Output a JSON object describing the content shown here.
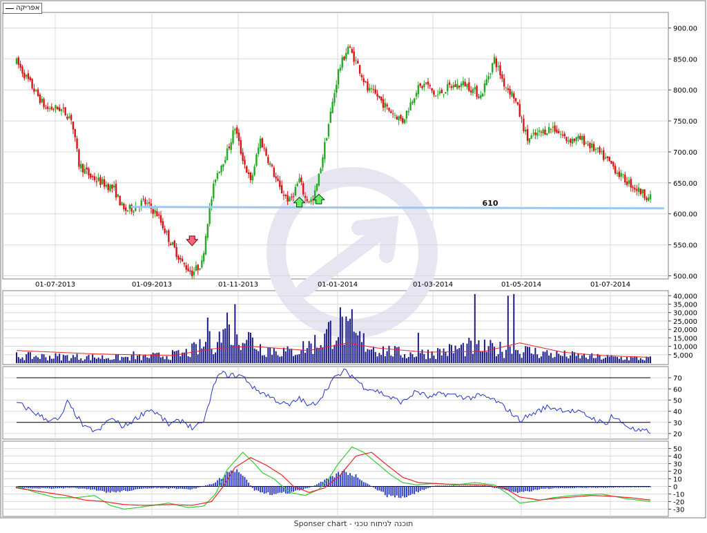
{
  "legend": {
    "label": "אפריקה"
  },
  "footer": {
    "text": "Sponser chart - תוכנה לניתוח טכני"
  },
  "colors": {
    "up": "#22aa22",
    "down": "#dd1111",
    "volume": "#1a1a8c",
    "ma": "#ee2222",
    "rsi": "#2233cc",
    "macd_fast": "#33cc33",
    "macd_slow": "#ee2222",
    "hist": "#2233cc",
    "support": "#9cc8f0",
    "grid": "#d8d8d8"
  },
  "chart_data": [
    {
      "type": "candlestick",
      "x_ticks": [
        "01-07-2013",
        "01-09-2013",
        "01-11-2013",
        "01-01-2014",
        "01-03-2014",
        "01-05-2014",
        "01-07-2014"
      ],
      "y_ticks": [
        "500.00",
        "550.00",
        "600.00",
        "650.00",
        "700.00",
        "750.00",
        "800.00",
        "850.00",
        "900.00"
      ],
      "ylim": [
        495,
        925
      ],
      "support_line": {
        "value": 610,
        "label": "610"
      },
      "keypoints": [
        [
          0,
          845
        ],
        [
          8,
          805
        ],
        [
          15,
          770
        ],
        [
          22,
          770
        ],
        [
          28,
          755
        ],
        [
          32,
          680
        ],
        [
          38,
          660
        ],
        [
          44,
          650
        ],
        [
          50,
          640
        ],
        [
          55,
          605
        ],
        [
          60,
          610
        ],
        [
          65,
          620
        ],
        [
          72,
          600
        ],
        [
          78,
          560
        ],
        [
          85,
          520
        ],
        [
          90,
          505
        ],
        [
          95,
          520
        ],
        [
          98,
          590
        ],
        [
          102,
          660
        ],
        [
          108,
          700
        ],
        [
          112,
          740
        ],
        [
          115,
          700
        ],
        [
          120,
          650
        ],
        [
          125,
          720
        ],
        [
          130,
          680
        ],
        [
          135,
          640
        ],
        [
          140,
          620
        ],
        [
          145,
          655
        ],
        [
          148,
          625
        ],
        [
          152,
          620
        ],
        [
          155,
          660
        ],
        [
          160,
          745
        ],
        [
          165,
          830
        ],
        [
          170,
          870
        ],
        [
          175,
          840
        ],
        [
          180,
          800
        ],
        [
          185,
          790
        ],
        [
          190,
          770
        ],
        [
          198,
          750
        ],
        [
          205,
          800
        ],
        [
          210,
          810
        ],
        [
          215,
          790
        ],
        [
          222,
          805
        ],
        [
          230,
          810
        ],
        [
          238,
          790
        ],
        [
          245,
          850
        ],
        [
          250,
          810
        ],
        [
          255,
          790
        ],
        [
          262,
          720
        ],
        [
          268,
          730
        ],
        [
          275,
          740
        ],
        [
          282,
          720
        ],
        [
          290,
          720
        ],
        [
          298,
          700
        ],
        [
          305,
          680
        ],
        [
          310,
          660
        ],
        [
          318,
          640
        ],
        [
          325,
          625
        ]
      ],
      "arrows": [
        {
          "dir": "down",
          "index": 90
        },
        {
          "dir": "up",
          "index": 145
        },
        {
          "dir": "up",
          "index": 155
        }
      ]
    },
    {
      "type": "bar",
      "name": "volume",
      "y_ticks": [
        "5,000",
        "10,000",
        "15,000",
        "20,000",
        "25,000",
        "30,000",
        "35,000",
        "40,000"
      ],
      "ylim": [
        0,
        43000
      ],
      "keypoints": [
        [
          0,
          4000
        ],
        [
          30,
          3500
        ],
        [
          60,
          3000
        ],
        [
          85,
          5000
        ],
        [
          95,
          9000
        ],
        [
          105,
          15000
        ],
        [
          115,
          18000
        ],
        [
          125,
          9000
        ],
        [
          140,
          6000
        ],
        [
          155,
          12000
        ],
        [
          165,
          22000
        ],
        [
          172,
          15000
        ],
        [
          185,
          8000
        ],
        [
          200,
          5000
        ],
        [
          215,
          6000
        ],
        [
          232,
          9000
        ],
        [
          245,
          8000
        ],
        [
          260,
          7000
        ],
        [
          275,
          5000
        ],
        [
          295,
          3500
        ],
        [
          325,
          2500
        ]
      ],
      "spikes": [
        [
          98,
          27000
        ],
        [
          108,
          30000
        ],
        [
          112,
          35000
        ],
        [
          170,
          25000
        ],
        [
          172,
          32000
        ],
        [
          235,
          41000
        ],
        [
          252,
          40000
        ],
        [
          255,
          41000
        ],
        [
          206,
          18000
        ],
        [
          60,
          7000
        ]
      ],
      "ma_keypoints": [
        [
          0,
          7500
        ],
        [
          40,
          5500
        ],
        [
          80,
          4500
        ],
        [
          100,
          8500
        ],
        [
          120,
          10000
        ],
        [
          150,
          7500
        ],
        [
          170,
          12000
        ],
        [
          185,
          9000
        ],
        [
          210,
          6500
        ],
        [
          240,
          7000
        ],
        [
          258,
          12000
        ],
        [
          280,
          6500
        ],
        [
          300,
          4500
        ],
        [
          325,
          3500
        ]
      ]
    },
    {
      "type": "line",
      "name": "rsi",
      "y_ticks": [
        "20",
        "30",
        "40",
        "50",
        "60",
        "70"
      ],
      "ylim": [
        15,
        80
      ],
      "levels": [
        30,
        70
      ],
      "keypoints": [
        [
          0,
          48
        ],
        [
          8,
          40
        ],
        [
          15,
          33
        ],
        [
          22,
          32
        ],
        [
          26,
          48
        ],
        [
          30,
          38
        ],
        [
          35,
          25
        ],
        [
          42,
          22
        ],
        [
          48,
          34
        ],
        [
          55,
          26
        ],
        [
          60,
          32
        ],
        [
          68,
          42
        ],
        [
          72,
          38
        ],
        [
          78,
          28
        ],
        [
          85,
          32
        ],
        [
          90,
          25
        ],
        [
          95,
          28
        ],
        [
          98,
          42
        ],
        [
          102,
          68
        ],
        [
          105,
          74
        ],
        [
          110,
          72
        ],
        [
          115,
          72
        ],
        [
          118,
          68
        ],
        [
          122,
          60
        ],
        [
          128,
          55
        ],
        [
          135,
          48
        ],
        [
          140,
          45
        ],
        [
          145,
          52
        ],
        [
          150,
          44
        ],
        [
          155,
          50
        ],
        [
          162,
          68
        ],
        [
          168,
          76
        ],
        [
          172,
          72
        ],
        [
          178,
          62
        ],
        [
          185,
          58
        ],
        [
          192,
          52
        ],
        [
          198,
          48
        ],
        [
          205,
          58
        ],
        [
          212,
          52
        ],
        [
          218,
          56
        ],
        [
          225,
          54
        ],
        [
          232,
          52
        ],
        [
          238,
          54
        ],
        [
          245,
          50
        ],
        [
          250,
          44
        ],
        [
          258,
          32
        ],
        [
          265,
          38
        ],
        [
          272,
          44
        ],
        [
          278,
          42
        ],
        [
          285,
          40
        ],
        [
          290,
          38
        ],
        [
          295,
          34
        ],
        [
          302,
          28
        ],
        [
          305,
          36
        ],
        [
          312,
          28
        ],
        [
          318,
          22
        ],
        [
          325,
          22
        ]
      ]
    },
    {
      "type": "line",
      "name": "macd",
      "y_ticks": [
        "-30",
        "-20",
        "-10",
        "0",
        "10",
        "20",
        "30",
        "40",
        "50"
      ],
      "ylim": [
        -36,
        56
      ],
      "zero_line": true,
      "fast_keypoints": [
        [
          0,
          0
        ],
        [
          10,
          -8
        ],
        [
          20,
          -15
        ],
        [
          30,
          -15
        ],
        [
          40,
          -12
        ],
        [
          48,
          -25
        ],
        [
          55,
          -30
        ],
        [
          62,
          -28
        ],
        [
          70,
          -25
        ],
        [
          78,
          -22
        ],
        [
          88,
          -28
        ],
        [
          96,
          -26
        ],
        [
          102,
          -10
        ],
        [
          108,
          22
        ],
        [
          116,
          45
        ],
        [
          122,
          30
        ],
        [
          126,
          18
        ],
        [
          132,
          10
        ],
        [
          140,
          -8
        ],
        [
          148,
          -12
        ],
        [
          155,
          -4
        ],
        [
          160,
          10
        ],
        [
          165,
          30
        ],
        [
          172,
          52
        ],
        [
          178,
          45
        ],
        [
          185,
          30
        ],
        [
          192,
          15
        ],
        [
          198,
          5
        ],
        [
          205,
          2
        ],
        [
          215,
          4
        ],
        [
          225,
          2
        ],
        [
          235,
          5
        ],
        [
          245,
          2
        ],
        [
          252,
          -10
        ],
        [
          258,
          -22
        ],
        [
          265,
          -20
        ],
        [
          275,
          -15
        ],
        [
          285,
          -12
        ],
        [
          300,
          -10
        ],
        [
          312,
          -16
        ],
        [
          325,
          -20
        ]
      ],
      "slow_keypoints": [
        [
          0,
          -2
        ],
        [
          15,
          -8
        ],
        [
          25,
          -12
        ],
        [
          35,
          -18
        ],
        [
          45,
          -20
        ],
        [
          55,
          -24
        ],
        [
          65,
          -25
        ],
        [
          80,
          -24
        ],
        [
          90,
          -25
        ],
        [
          100,
          -20
        ],
        [
          106,
          0
        ],
        [
          112,
          25
        ],
        [
          120,
          38
        ],
        [
          128,
          28
        ],
        [
          136,
          15
        ],
        [
          142,
          0
        ],
        [
          150,
          -8
        ],
        [
          158,
          -2
        ],
        [
          166,
          15
        ],
        [
          174,
          40
        ],
        [
          182,
          45
        ],
        [
          190,
          28
        ],
        [
          198,
          12
        ],
        [
          206,
          5
        ],
        [
          220,
          3
        ],
        [
          240,
          2
        ],
        [
          250,
          -2
        ],
        [
          258,
          -14
        ],
        [
          268,
          -18
        ],
        [
          280,
          -15
        ],
        [
          295,
          -12
        ],
        [
          305,
          -13
        ],
        [
          315,
          -15
        ],
        [
          325,
          -18
        ]
      ],
      "hist_keypoints": [
        [
          0,
          -2
        ],
        [
          20,
          -3
        ],
        [
          30,
          -2
        ],
        [
          40,
          -5
        ],
        [
          48,
          -8
        ],
        [
          55,
          -6
        ],
        [
          70,
          -2
        ],
        [
          90,
          -4
        ],
        [
          102,
          5
        ],
        [
          108,
          18
        ],
        [
          112,
          22
        ],
        [
          116,
          14
        ],
        [
          122,
          -5
        ],
        [
          130,
          -10
        ],
        [
          140,
          -8
        ],
        [
          150,
          -2
        ],
        [
          160,
          10
        ],
        [
          168,
          20
        ],
        [
          174,
          14
        ],
        [
          182,
          0
        ],
        [
          190,
          -12
        ],
        [
          198,
          -15
        ],
        [
          205,
          -8
        ],
        [
          215,
          1
        ],
        [
          240,
          1
        ],
        [
          250,
          -5
        ],
        [
          258,
          -8
        ],
        [
          270,
          -3
        ],
        [
          290,
          -2
        ],
        [
          325,
          -1
        ]
      ]
    }
  ]
}
